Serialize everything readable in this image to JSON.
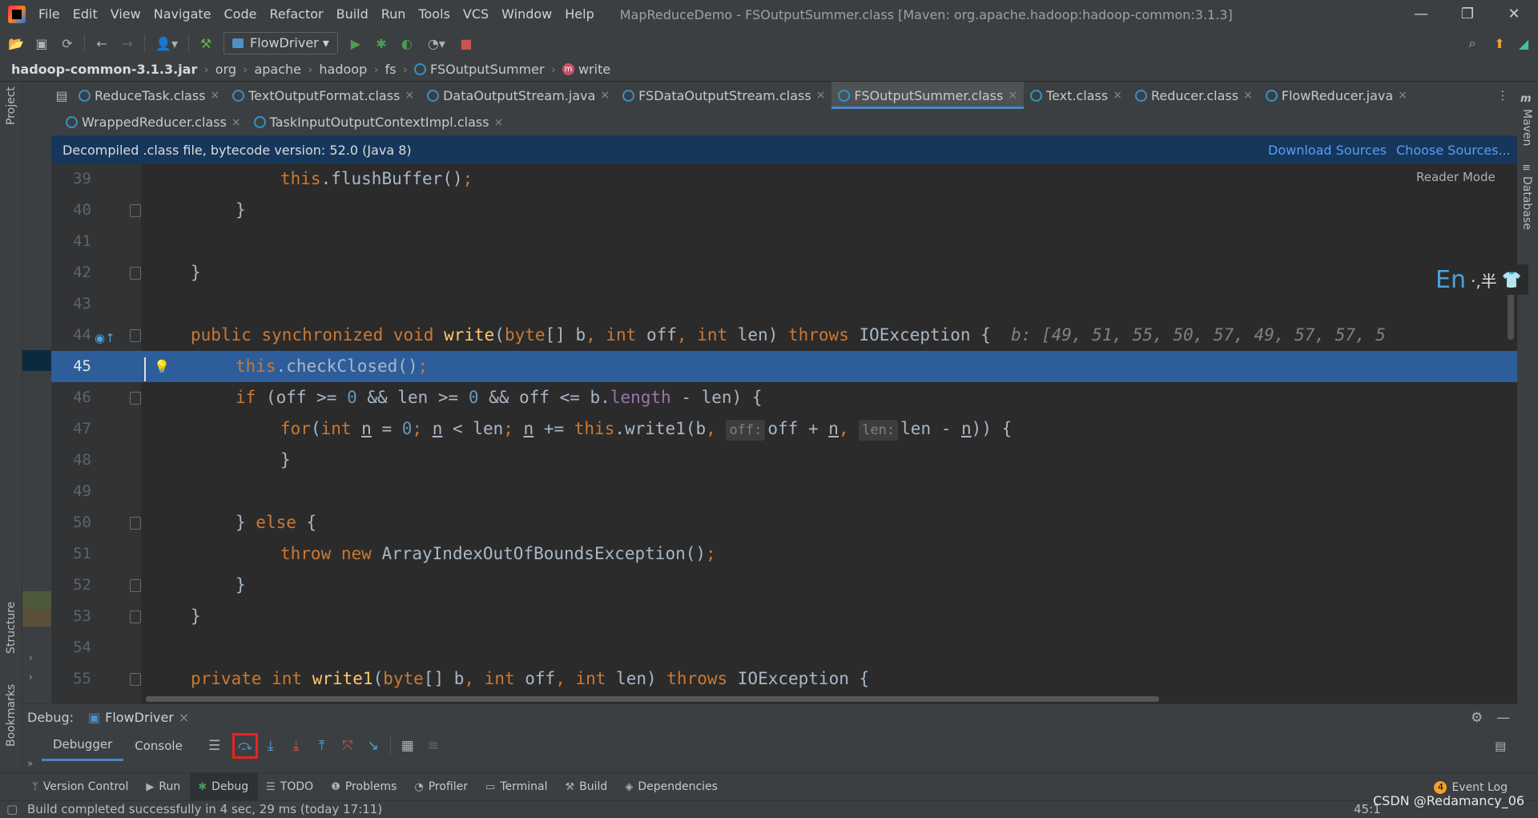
{
  "menubar": {
    "items": [
      "File",
      "Edit",
      "View",
      "Navigate",
      "Code",
      "Refactor",
      "Build",
      "Run",
      "Tools",
      "VCS",
      "Window",
      "Help"
    ],
    "title": "MapReduceDemo - FSOutputSummer.class [Maven: org.apache.hadoop:hadoop-common:3.1.3]",
    "minimize": "—",
    "restore": "❐",
    "close": "✕"
  },
  "toolbar": {
    "run_config": "FlowDriver"
  },
  "breadcrumb": {
    "items": [
      "hadoop-common-3.1.3.jar",
      "org",
      "apache",
      "hadoop",
      "fs",
      "FSOutputSummer",
      "write"
    ]
  },
  "tabs": {
    "row1": [
      "ReduceTask.class",
      "TextOutputFormat.class",
      "DataOutputStream.java",
      "FSDataOutputStream.class",
      "FSOutputSummer.class",
      "Text.class",
      "Reducer.class",
      "FlowReducer.java"
    ],
    "row2": [
      "WrappedReducer.class",
      "TaskInputOutputContextImpl.class"
    ],
    "active": "FSOutputSummer.class"
  },
  "banner": {
    "message": "Decompiled .class file, bytecode version: 52.0 (Java 8)",
    "download_sources": "Download Sources",
    "choose_sources": "Choose Sources..."
  },
  "editor": {
    "reader_mode": "Reader Mode",
    "current_line": 45,
    "line_numbers": [
      "39",
      "40",
      "41",
      "42",
      "43",
      "44",
      "45",
      "46",
      "47",
      "48",
      "49",
      "50",
      "51",
      "52",
      "53",
      "54",
      "55"
    ],
    "inline_debug_value": "b: [49, 51, 55, 50, 57, 49, 57, 57, 5",
    "hint_off": "off:",
    "hint_len": "len:"
  },
  "ime": {
    "lang": "En",
    "symbols": "·,半"
  },
  "debug": {
    "label": "Debug:",
    "session": "FlowDriver",
    "tabs": [
      "Debugger",
      "Console"
    ],
    "active_tab": "Debugger",
    "highlighted_button": "step-over"
  },
  "tool_tabs": {
    "items": [
      "Version Control",
      "Run",
      "Debug",
      "TODO",
      "Problems",
      "Profiler",
      "Terminal",
      "Build",
      "Dependencies"
    ],
    "active": "Debug",
    "event_log": "Event Log",
    "event_count": "4"
  },
  "left_strip": {
    "project": "Project",
    "structure": "Structure",
    "bookmarks": "Bookmarks"
  },
  "right_strip": {
    "maven": "Maven",
    "database": "Database"
  },
  "status": {
    "message": "Build completed successfully in 4 sec, 29 ms (today 17:11)",
    "position": "45:1"
  },
  "watermark": "CSDN @Redamancy_06",
  "colors": {
    "keyword": "#cc7832",
    "method": "#ffc66d",
    "field": "#9876aa",
    "number": "#6897bb",
    "current_line": "#2d5d9a",
    "accent": "#4a88c7",
    "highlight_box": "#e8251d"
  }
}
